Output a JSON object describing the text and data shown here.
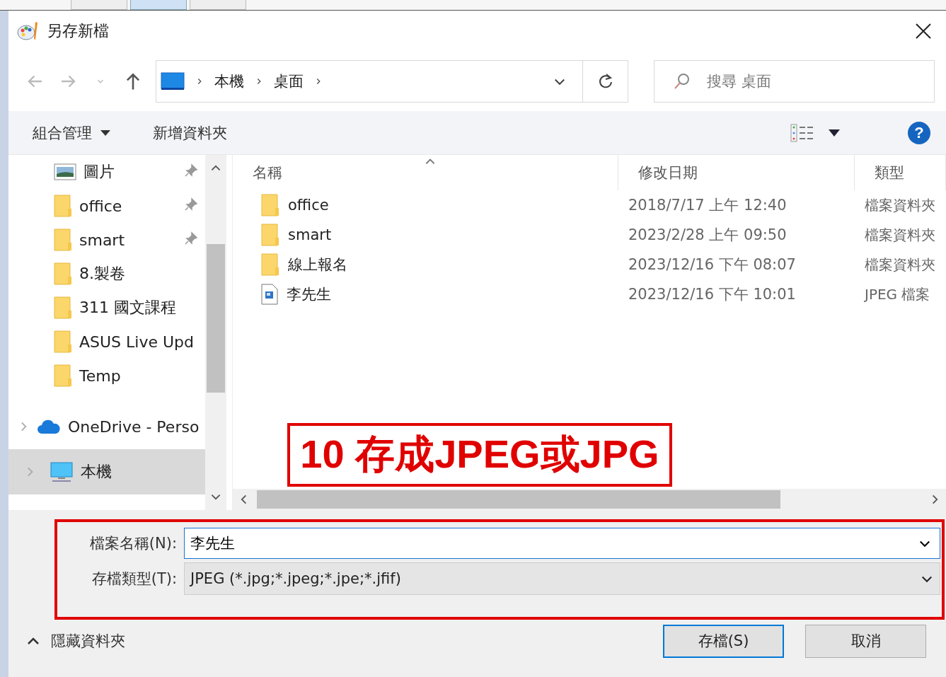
{
  "window": {
    "title": "另存新檔"
  },
  "address_bar": {
    "path": [
      "本機",
      "桌面"
    ]
  },
  "search": {
    "placeholder": "搜尋 桌面"
  },
  "toolbar": {
    "organize": "組合管理",
    "new_folder": "新增資料夾",
    "help": "?"
  },
  "nav_pane": {
    "items": [
      {
        "label": "圖片",
        "kind": "pictures",
        "pinned": true,
        "selected": false
      },
      {
        "label": "office",
        "kind": "folder",
        "pinned": true,
        "selected": false
      },
      {
        "label": "smart",
        "kind": "folder",
        "pinned": true,
        "selected": false
      },
      {
        "label": "8.製卷",
        "kind": "folder",
        "pinned": false,
        "selected": false
      },
      {
        "label": "311 國文課程",
        "kind": "folder",
        "pinned": false,
        "selected": false
      },
      {
        "label": "ASUS Live Upd",
        "kind": "folder",
        "pinned": false,
        "selected": false
      },
      {
        "label": "Temp",
        "kind": "folder",
        "pinned": false,
        "selected": false
      },
      {
        "label": "OneDrive - Perso",
        "kind": "cloud",
        "pinned": false,
        "selected": false
      },
      {
        "label": "本機",
        "kind": "pc",
        "pinned": false,
        "selected": true
      }
    ]
  },
  "file_list": {
    "columns": [
      "名稱",
      "修改日期",
      "類型"
    ],
    "rows": [
      {
        "name": "office",
        "date": "2018/7/17 上午 12:40",
        "type": "檔案資料夾",
        "kind": "folder"
      },
      {
        "name": "smart",
        "date": "2023/2/28 上午 09:50",
        "type": "檔案資料夾",
        "kind": "folder"
      },
      {
        "name": "線上報名",
        "date": "2023/12/16 下午 08:07",
        "type": "檔案資料夾",
        "kind": "folder"
      },
      {
        "name": "李先生",
        "date": "2023/12/16 下午 10:01",
        "type": "JPEG 檔案",
        "kind": "image"
      }
    ]
  },
  "file_name": {
    "label": "檔案名稱(N):",
    "value": "李先生"
  },
  "file_type": {
    "label": "存檔類型(T):",
    "value": "JPEG (*.jpg;*.jpeg;*.jpe;*.jfif)"
  },
  "hide_folders": "隱藏資料夾",
  "buttons": [
    {
      "label": "存檔(S)",
      "kind": "primary"
    },
    {
      "label": "取消",
      "kind": "default"
    }
  ],
  "annotation": {
    "text": "10 存成JPEG或JPG"
  }
}
